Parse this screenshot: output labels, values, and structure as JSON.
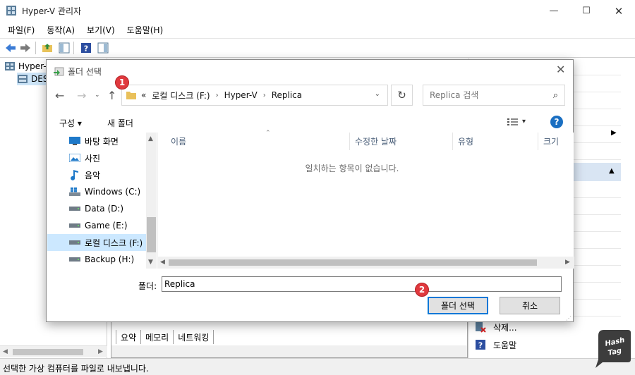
{
  "window": {
    "title": "Hyper-V 관리자",
    "controls": {
      "minimize": "—",
      "maximize": "☐",
      "close": "✕"
    }
  },
  "menu": [
    "파일(F)",
    "동작(A)",
    "보기(V)",
    "도움말(H)"
  ],
  "tree": {
    "root": "Hyper-V",
    "child": "DES"
  },
  "bottom_tabs": [
    "요약",
    "메모리",
    "네트워킹"
  ],
  "actions": {
    "delete_label": "삭제...",
    "help_label": "도움말"
  },
  "status": "선택한 가상 컴퓨터를 파일로 내보냅니다.",
  "logo": {
    "line1": "Hash",
    "line2": "Tag"
  },
  "dialog": {
    "title": "폴더 선택",
    "address": {
      "overflow": "«",
      "crumbs": [
        "로컬 디스크 (F:)",
        "Hyper-V",
        "Replica"
      ]
    },
    "search_placeholder": "Replica 검색",
    "commands": {
      "organize": "구성",
      "new_folder": "새 폴더"
    },
    "nav_items": [
      {
        "label": "바탕 화면",
        "icon": "desktop-icon"
      },
      {
        "label": "사진",
        "icon": "pictures-icon"
      },
      {
        "label": "음악",
        "icon": "music-icon"
      },
      {
        "label": "Windows (C:)",
        "icon": "windows-drive-icon"
      },
      {
        "label": "Data (D:)",
        "icon": "drive-icon"
      },
      {
        "label": "Game (E:)",
        "icon": "drive-icon"
      },
      {
        "label": "로컬 디스크 (F:)",
        "icon": "drive-icon",
        "selected": true
      },
      {
        "label": "Backup (H:)",
        "icon": "drive-icon"
      }
    ],
    "columns": [
      "이름",
      "수정한 날짜",
      "유형",
      "크기"
    ],
    "empty_message": "일치하는 항목이 없습니다.",
    "folder_label": "폴더:",
    "folder_value": "Replica",
    "buttons": {
      "select": "폴더 선택",
      "cancel": "취소"
    },
    "badges": [
      "1",
      "2"
    ]
  },
  "colors": {
    "accent": "#0078d7",
    "badge": "#e0393e",
    "selection": "#cce8ff",
    "help": "#1a6fc2"
  }
}
